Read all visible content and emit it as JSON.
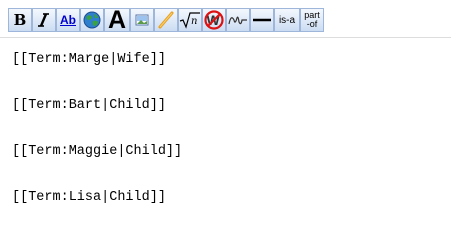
{
  "toolbar": {
    "buttons": [
      {
        "name": "bold-button",
        "label": "B"
      },
      {
        "name": "italic-button",
        "icon": "italic-icon"
      },
      {
        "name": "link-button",
        "label": "Ab"
      },
      {
        "name": "external-link-button",
        "icon": "globe-icon"
      },
      {
        "name": "heading-button",
        "label": "A"
      },
      {
        "name": "image-button",
        "icon": "image-icon"
      },
      {
        "name": "media-button",
        "icon": "media-icon"
      },
      {
        "name": "math-button",
        "label": "√n",
        "icon": "sqrt-icon"
      },
      {
        "name": "nowiki-button",
        "label": "W",
        "icon": "nowiki-icon"
      },
      {
        "name": "signature-button",
        "icon": "signature-icon"
      },
      {
        "name": "horizontal-line-button",
        "icon": "horizontal-line-icon"
      },
      {
        "name": "is-a-button",
        "label": "is-a"
      },
      {
        "name": "part-of-button",
        "label_line1": "part",
        "label_line2": "-of"
      }
    ]
  },
  "editor": {
    "lines": [
      "[[Term:Marge|Wife]]",
      "[[Term:Bart|Child]]",
      "[[Term:Maggie|Child]]",
      "[[Term:Lisa|Child]]"
    ]
  }
}
